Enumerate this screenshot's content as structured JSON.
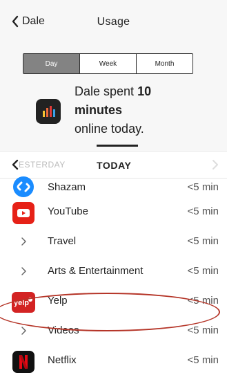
{
  "nav": {
    "back_label": "Dale",
    "title": "Usage"
  },
  "segments": [
    "Day",
    "Week",
    "Month"
  ],
  "active_segment": "Day",
  "summary": {
    "prefix": "Dale spent",
    "amount": "10",
    "unit": "minutes",
    "suffix": "online today."
  },
  "day_nav": {
    "previous": "ESTERDAY",
    "current": "TODAY"
  },
  "items": [
    {
      "label": "Shazam",
      "time": "<5 min",
      "kind": "app",
      "icon": "shazam-icon"
    },
    {
      "label": "YouTube",
      "time": "<5 min",
      "kind": "app",
      "icon": "youtube-icon"
    },
    {
      "label": "Travel",
      "time": "<5 min",
      "kind": "category",
      "icon": "chevron-right-icon"
    },
    {
      "label": "Arts & Entertainment",
      "time": "<5 min",
      "kind": "category",
      "icon": "chevron-right-icon"
    },
    {
      "label": "Yelp",
      "time": "<5 min",
      "kind": "app",
      "icon": "yelp-icon",
      "highlighted": true
    },
    {
      "label": "Videos",
      "time": "<5 min",
      "kind": "category",
      "icon": "chevron-right-icon"
    },
    {
      "label": "Netflix",
      "time": "<5 min",
      "kind": "app",
      "icon": "netflix-icon"
    }
  ],
  "colors": {
    "highlight_ring": "#b53528",
    "segment_active": "#838383",
    "yelp_red": "#d32323",
    "youtube_red": "#e62117",
    "shazam_blue": "#1a8cff",
    "netflix_red": "#e50914"
  },
  "icon_text": {
    "yelp": "yelp"
  }
}
